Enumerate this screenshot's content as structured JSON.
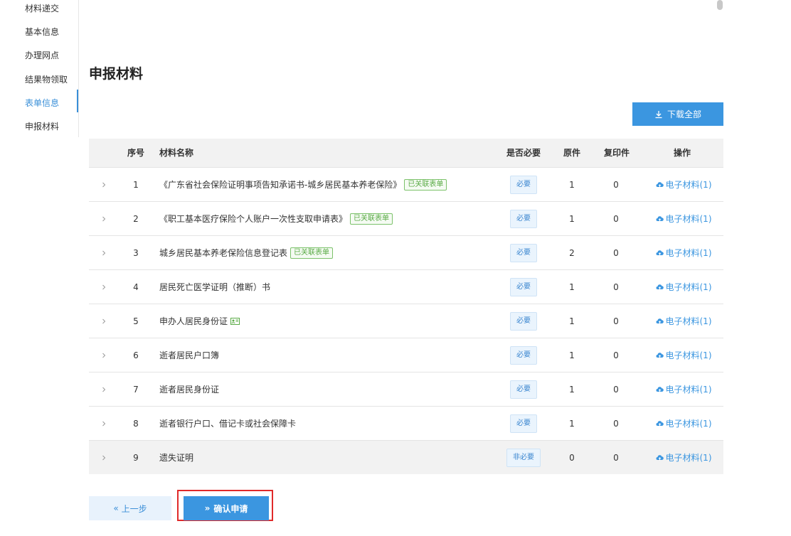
{
  "sidebar": {
    "items": [
      {
        "label": "材料递交"
      },
      {
        "label": "基本信息"
      },
      {
        "label": "办理网点"
      },
      {
        "label": "结果物领取"
      },
      {
        "label": "表单信息",
        "active": true
      },
      {
        "label": "申报材料"
      }
    ]
  },
  "section": {
    "title": "申报材料",
    "download_all_label": "下载全部"
  },
  "table": {
    "headers": {
      "no": "序号",
      "name": "材料名称",
      "required": "是否必要",
      "original": "原件",
      "copies": "复印件",
      "operation": "操作"
    },
    "rows": [
      {
        "no": "1",
        "name": "《广东省社会保险证明事项告知承诺书-城乡居民基本养老保险》",
        "tag": "已关联表单",
        "required": "必要",
        "original": "1",
        "copies": "0",
        "action": "电子材料(1)"
      },
      {
        "no": "2",
        "name": "《职工基本医疗保险个人账户一次性支取申请表》",
        "tag": "已关联表单",
        "required": "必要",
        "original": "1",
        "copies": "0",
        "action": "电子材料(1)"
      },
      {
        "no": "3",
        "name": "城乡居民基本养老保险信息登记表",
        "tag": "已关联表单",
        "required": "必要",
        "original": "2",
        "copies": "0",
        "action": "电子材料(1)"
      },
      {
        "no": "4",
        "name": "居民死亡医学证明（推断）书",
        "tag": "",
        "required": "必要",
        "original": "1",
        "copies": "0",
        "action": "电子材料(1)"
      },
      {
        "no": "5",
        "name": "申办人居民身份证",
        "tag": "",
        "icon": "id-card-icon",
        "required": "必要",
        "original": "1",
        "copies": "0",
        "action": "电子材料(1)"
      },
      {
        "no": "6",
        "name": "逝者居民户口簿",
        "tag": "",
        "required": "必要",
        "original": "1",
        "copies": "0",
        "action": "电子材料(1)"
      },
      {
        "no": "7",
        "name": "逝者居民身份证",
        "tag": "",
        "required": "必要",
        "original": "1",
        "copies": "0",
        "action": "电子材料(1)"
      },
      {
        "no": "8",
        "name": "逝者银行户口、借记卡或社会保障卡",
        "tag": "",
        "required": "必要",
        "original": "1",
        "copies": "0",
        "action": "电子材料(1)"
      },
      {
        "no": "9",
        "name": "遗失证明",
        "tag": "",
        "required": "非必要",
        "original": "0",
        "copies": "0",
        "action": "电子材料(1)"
      }
    ]
  },
  "footer": {
    "prev_label": "上一步",
    "confirm_label": "确认申请"
  },
  "colors": {
    "accent": "#3b96e0",
    "tag_green": "#5aab46",
    "highlight_red": "#e02a2a"
  }
}
